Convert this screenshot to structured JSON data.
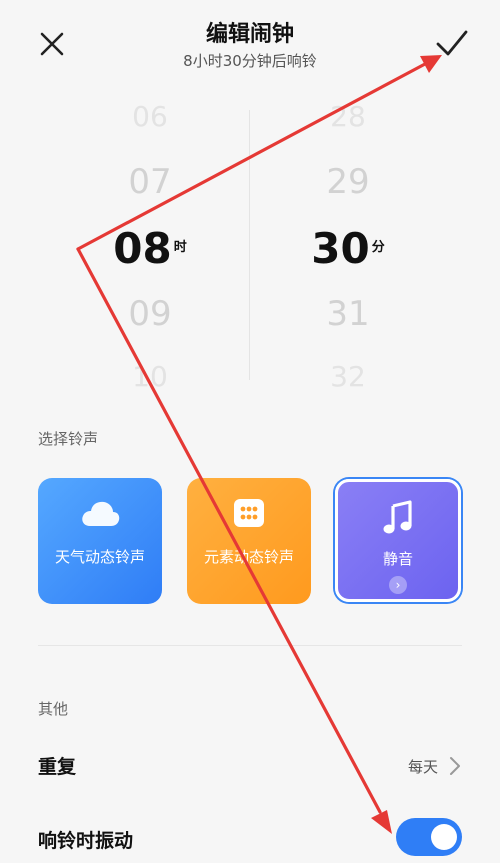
{
  "header": {
    "title": "编辑闹钟",
    "subtitle": "8小时30分钟后响铃"
  },
  "picker": {
    "hours": [
      "06",
      "07",
      "08",
      "09",
      "10"
    ],
    "hour_selected": "08",
    "hour_unit": "时",
    "minutes": [
      "28",
      "29",
      "30",
      "31",
      "32"
    ],
    "minute_selected": "30",
    "minute_unit": "分"
  },
  "ringtone": {
    "section_label": "选择铃声",
    "cards": [
      {
        "label": "天气动态铃声",
        "icon": "cloud-icon"
      },
      {
        "label": "元素动态铃声",
        "icon": "grid-icon"
      },
      {
        "label": "静音",
        "icon": "music-note-icon",
        "selected": true
      }
    ]
  },
  "other": {
    "section_label": "其他",
    "repeat_label": "重复",
    "repeat_value": "每天",
    "vibrate_label": "响铃时振动",
    "vibrate_on": true
  },
  "colors": {
    "accent": "#2f7ef6",
    "annotation": "#e53935"
  }
}
